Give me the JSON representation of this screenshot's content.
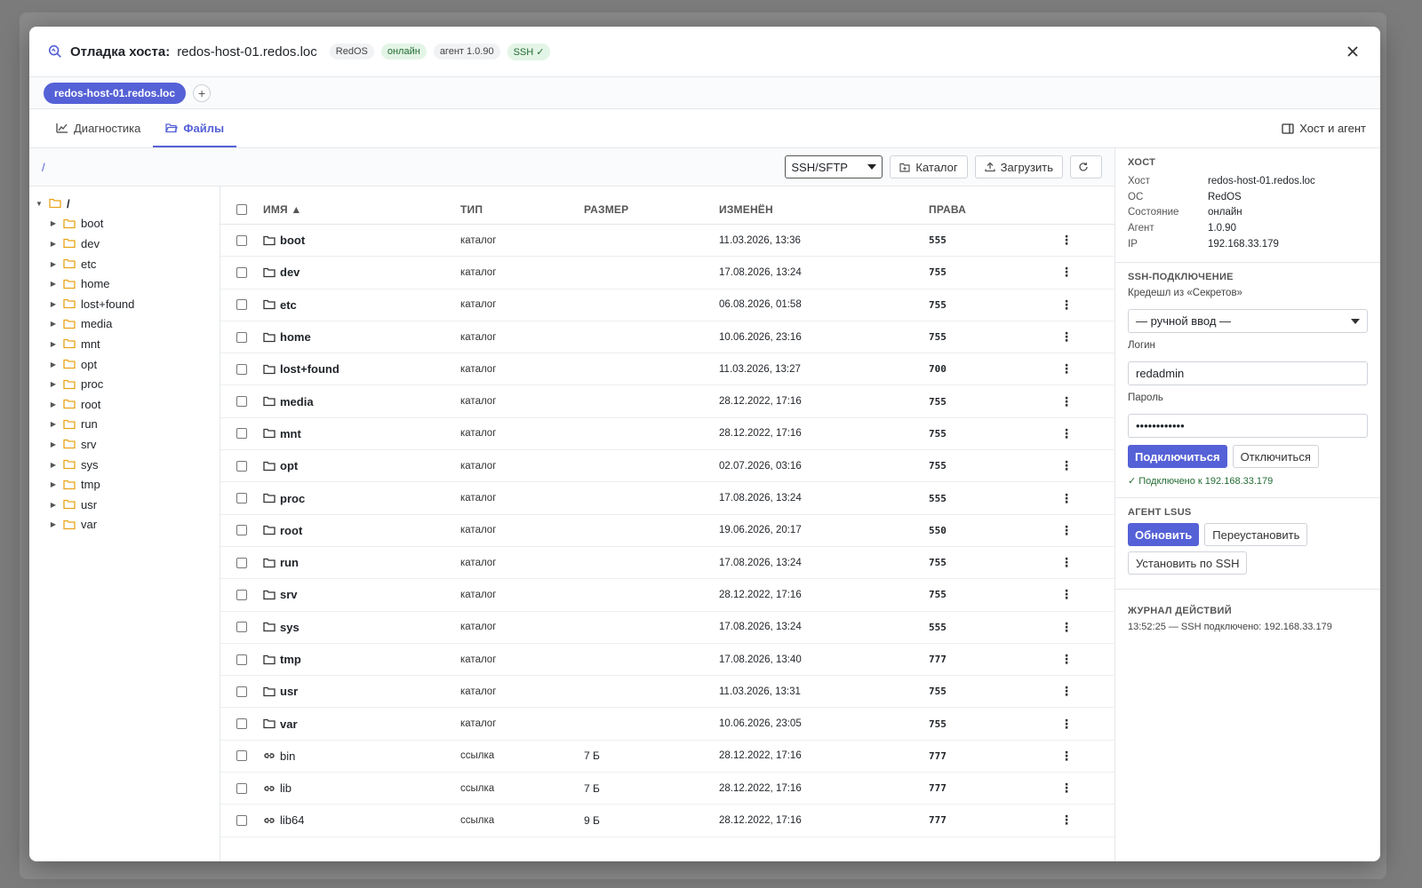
{
  "header": {
    "title": "Отладка хоста:",
    "host": "redos-host-01.redos.loc",
    "badges": [
      "RedOS",
      "онлайн",
      "агент 1.0.90",
      "SSH ✓"
    ]
  },
  "host_tabs": {
    "active": "redos-host-01.redos.loc",
    "add": "+"
  },
  "tabs": {
    "diagnostics": "Диагностика",
    "files": "Файлы",
    "right": "Хост и агент"
  },
  "toolbar": {
    "path": "/",
    "protocol": "SSH/SFTP",
    "catalog": "Каталог",
    "upload": "Загрузить"
  },
  "tree": {
    "root": "/",
    "children": [
      "boot",
      "dev",
      "etc",
      "home",
      "lost+found",
      "media",
      "mnt",
      "opt",
      "proc",
      "root",
      "run",
      "srv",
      "sys",
      "tmp",
      "usr",
      "var"
    ]
  },
  "grid": {
    "columns": {
      "name": "Имя ▲",
      "type": "Тип",
      "size": "Размер",
      "modified": "Изменён",
      "perms": "Права"
    },
    "rows": [
      {
        "name": "boot",
        "type": "каталог",
        "size": "",
        "modified": "11.03.2026, 13:36",
        "perms": "555",
        "kind": "dir"
      },
      {
        "name": "dev",
        "type": "каталог",
        "size": "",
        "modified": "17.08.2026, 13:24",
        "perms": "755",
        "kind": "dir"
      },
      {
        "name": "etc",
        "type": "каталог",
        "size": "",
        "modified": "06.08.2026, 01:58",
        "perms": "755",
        "kind": "dir"
      },
      {
        "name": "home",
        "type": "каталог",
        "size": "",
        "modified": "10.06.2026, 23:16",
        "perms": "755",
        "kind": "dir"
      },
      {
        "name": "lost+found",
        "type": "каталог",
        "size": "",
        "modified": "11.03.2026, 13:27",
        "perms": "700",
        "kind": "dir"
      },
      {
        "name": "media",
        "type": "каталог",
        "size": "",
        "modified": "28.12.2022, 17:16",
        "perms": "755",
        "kind": "dir"
      },
      {
        "name": "mnt",
        "type": "каталог",
        "size": "",
        "modified": "28.12.2022, 17:16",
        "perms": "755",
        "kind": "dir"
      },
      {
        "name": "opt",
        "type": "каталог",
        "size": "",
        "modified": "02.07.2026, 03:16",
        "perms": "755",
        "kind": "dir"
      },
      {
        "name": "proc",
        "type": "каталог",
        "size": "",
        "modified": "17.08.2026, 13:24",
        "perms": "555",
        "kind": "dir"
      },
      {
        "name": "root",
        "type": "каталог",
        "size": "",
        "modified": "19.06.2026, 20:17",
        "perms": "550",
        "kind": "dir"
      },
      {
        "name": "run",
        "type": "каталог",
        "size": "",
        "modified": "17.08.2026, 13:24",
        "perms": "755",
        "kind": "dir"
      },
      {
        "name": "srv",
        "type": "каталог",
        "size": "",
        "modified": "28.12.2022, 17:16",
        "perms": "755",
        "kind": "dir"
      },
      {
        "name": "sys",
        "type": "каталог",
        "size": "",
        "modified": "17.08.2026, 13:24",
        "perms": "555",
        "kind": "dir"
      },
      {
        "name": "tmp",
        "type": "каталог",
        "size": "",
        "modified": "17.08.2026, 13:40",
        "perms": "777",
        "kind": "dir"
      },
      {
        "name": "usr",
        "type": "каталог",
        "size": "",
        "modified": "11.03.2026, 13:31",
        "perms": "755",
        "kind": "dir"
      },
      {
        "name": "var",
        "type": "каталог",
        "size": "",
        "modified": "10.06.2026, 23:05",
        "perms": "755",
        "kind": "dir"
      },
      {
        "name": "bin",
        "type": "ссылка",
        "size": "7 Б",
        "modified": "28.12.2022, 17:16",
        "perms": "777",
        "kind": "link"
      },
      {
        "name": "lib",
        "type": "ссылка",
        "size": "7 Б",
        "modified": "28.12.2022, 17:16",
        "perms": "777",
        "kind": "link"
      },
      {
        "name": "lib64",
        "type": "ссылка",
        "size": "9 Б",
        "modified": "28.12.2022, 17:16",
        "perms": "777",
        "kind": "link"
      }
    ]
  },
  "side": {
    "host_section": {
      "title": "Хост",
      "rows": [
        {
          "k": "Хост",
          "v": "redos-host-01.redos.loc"
        },
        {
          "k": "ОС",
          "v": "RedOS"
        },
        {
          "k": "Состояние",
          "v": "онлайн"
        },
        {
          "k": "Агент",
          "v": "1.0.90"
        },
        {
          "k": "IP",
          "v": "192.168.33.179"
        }
      ]
    },
    "ssh": {
      "title": "SSH-подключение",
      "cred_label": "Кредешл из «Секретов»",
      "cred_value": "— ручной ввод —",
      "login_label": "Логин",
      "login_value": "redadmin",
      "password_label": "Пароль",
      "password_value": "••••••••••••",
      "connect": "Подключиться",
      "disconnect": "Отключиться",
      "status": "✓ Подключено к 192.168.33.179"
    },
    "agent": {
      "title": "Агент LSUS",
      "update": "Обновить",
      "reinstall": "Переустановить",
      "install_ssh": "Установить по SSH"
    },
    "log": {
      "title": "Журнал действий",
      "entries": [
        "13:52:25 — SSH подключено: 192.168.33.179"
      ]
    }
  }
}
